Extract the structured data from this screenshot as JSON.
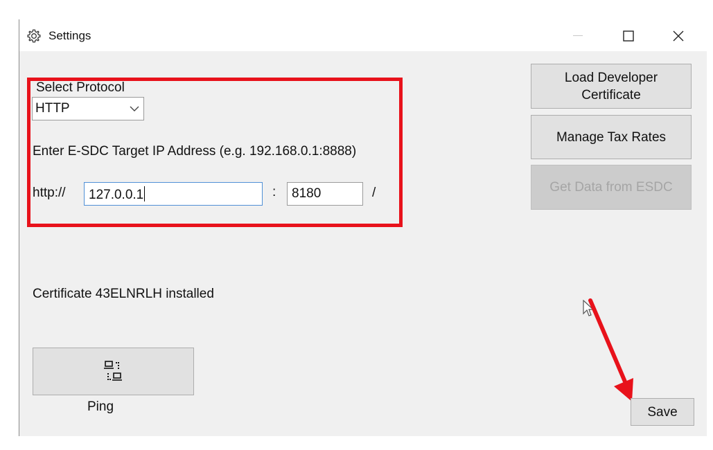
{
  "window": {
    "title": "Settings",
    "icon": "gear-icon",
    "controls": {
      "minimize": "minimize-icon",
      "maximize": "maximize-icon",
      "close": "close-icon"
    }
  },
  "protocol": {
    "label": "Select Protocol",
    "selected": "HTTP"
  },
  "target": {
    "instruction": "Enter E-SDC Target IP Address (e.g. 192.168.0.1:8888)",
    "scheme_label": "http://",
    "ip_value": "127.0.0.1",
    "separator": ":",
    "port_value": "8180",
    "suffix": "/"
  },
  "buttons": {
    "load_cert": "Load Developer Certificate",
    "manage_tax": "Manage Tax Rates",
    "get_data": "Get Data from ESDC",
    "save": "Save"
  },
  "status": {
    "certificate": "Certificate 43ELNRLH installed"
  },
  "ping": {
    "icon": "network-icon",
    "label": "Ping"
  },
  "annotations": {
    "highlight_color": "#e8121b",
    "arrow_color": "#e8121b"
  }
}
